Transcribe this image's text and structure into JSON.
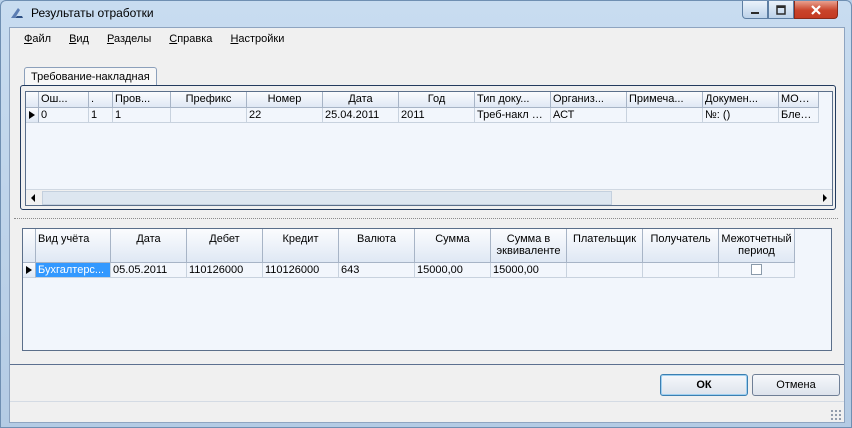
{
  "window": {
    "title": "Результаты отработки"
  },
  "menu": [
    {
      "mnemonic": "Ф",
      "rest": "айл"
    },
    {
      "mnemonic": "В",
      "rest": "ид"
    },
    {
      "mnemonic": "Р",
      "rest": "азделы"
    },
    {
      "mnemonic": "С",
      "rest": "правка"
    },
    {
      "mnemonic": "Н",
      "rest": "астройки"
    }
  ],
  "tab": {
    "label": "Требование-накладная"
  },
  "grid1": {
    "headers": [
      "Ош...",
      ".",
      "Пров...",
      "Префикс",
      "Номер",
      "Дата",
      "Год",
      "Тип доку...",
      "Организ...",
      "Примеча...",
      "Докумен...",
      "МОЛ - о"
    ],
    "rows": [
      [
        "0",
        "1",
        "1",
        "",
        "22",
        "25.04.2011",
        "2011",
        "Треб-накл ОС",
        "АСТ",
        "",
        "№: ()",
        "Бледны"
      ]
    ]
  },
  "grid2": {
    "headers": [
      "Вид учёта",
      "Дата",
      "Дебет",
      "Кредит",
      "Валюта",
      "Сумма",
      "Сумма в эквиваленте",
      "Плательщик",
      "Получатель",
      "Межотчетный период"
    ],
    "rows": [
      [
        "Бухгалтерс...",
        "05.05.2011",
        "110126000",
        "110126000",
        "643",
        "15000,00",
        "15000,00",
        "",
        "",
        ""
      ]
    ]
  },
  "buttons": {
    "ok": "ОК",
    "cancel": "Отмена"
  },
  "colors": {
    "selection": "#3399ff",
    "close_button": "#c9442b"
  }
}
